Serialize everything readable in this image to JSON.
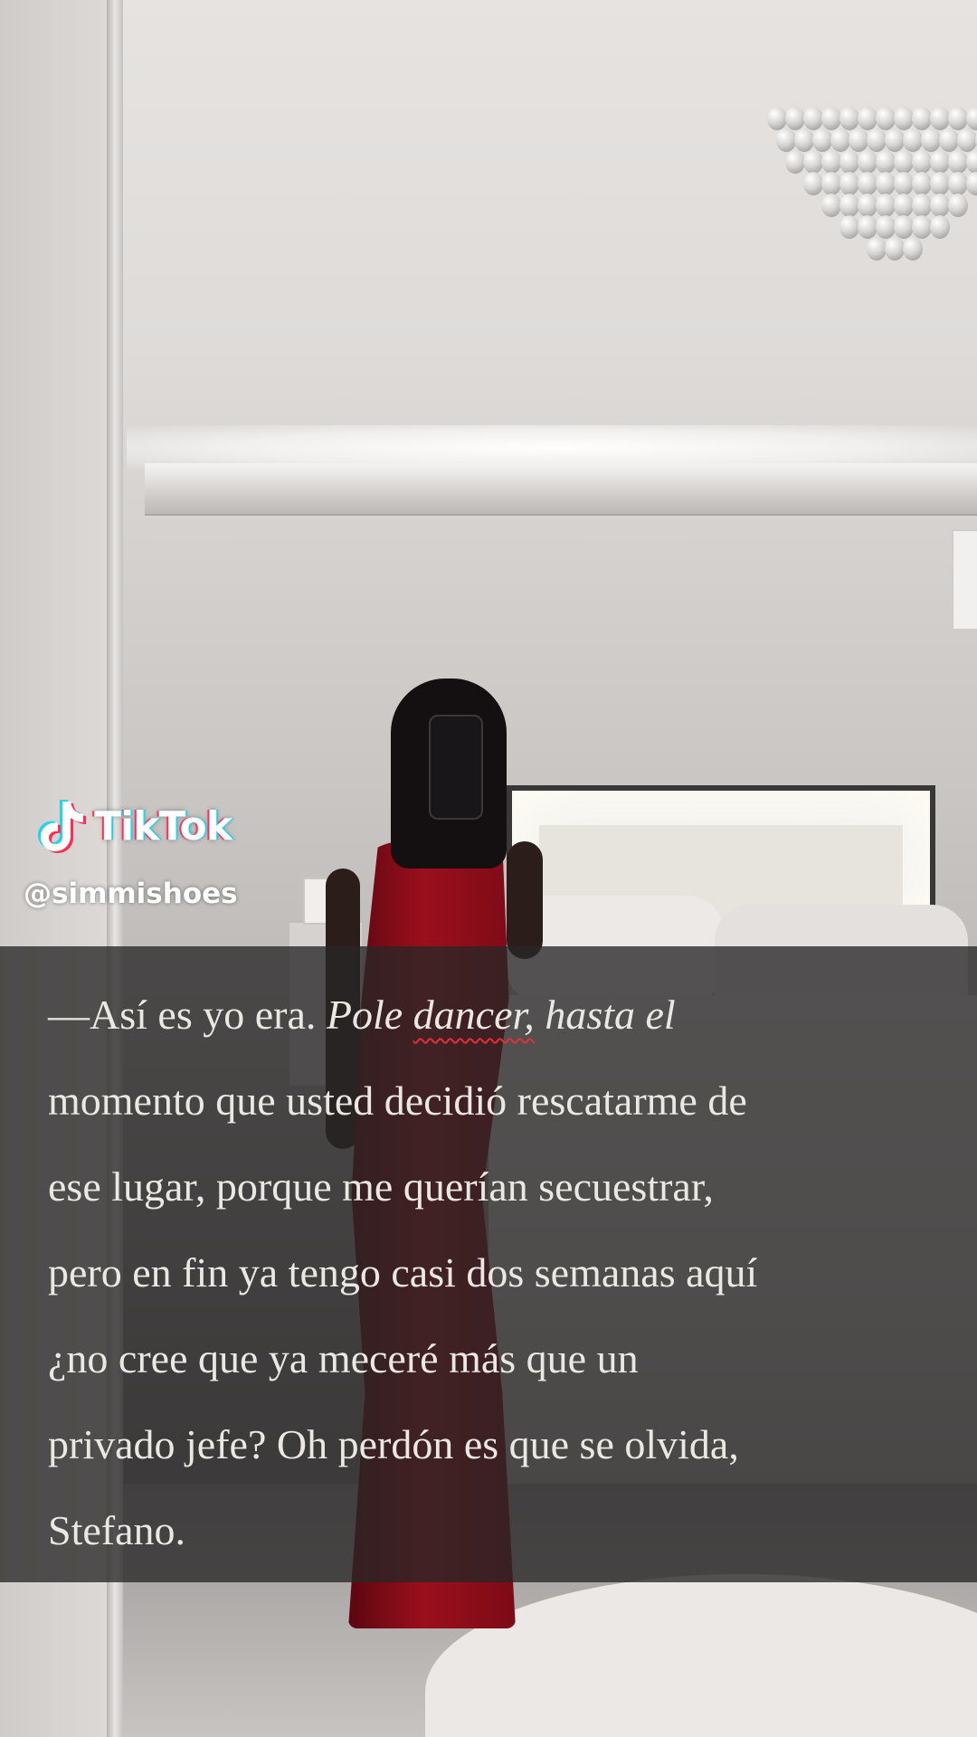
{
  "watermark": {
    "brand": "TikTok",
    "username": "@simmishoes",
    "logo_icon": "tiktok-note-icon"
  },
  "story": {
    "part1": "—Así es yo era. ",
    "part2": "Pole ",
    "part3": "dancer,",
    "part4": " hasta el",
    "line2": "momento que usted decidió rescatarme de",
    "line3": "ese lugar, porque me querían secuestrar,",
    "line4": "pero en fin ya tengo casi dos semanas aquí",
    "line5": "¿no cree que ya meceré más que un",
    "line6": "privado jefe? Oh perdón es que se olvida,",
    "line7": "Stefano."
  },
  "colors": {
    "overlay": "#282626",
    "text": "#ebe7e3",
    "spellcheck_underline": "#e0303a",
    "tiktok_cyan": "#22d3ee",
    "tiktok_red": "#ff2d55"
  }
}
